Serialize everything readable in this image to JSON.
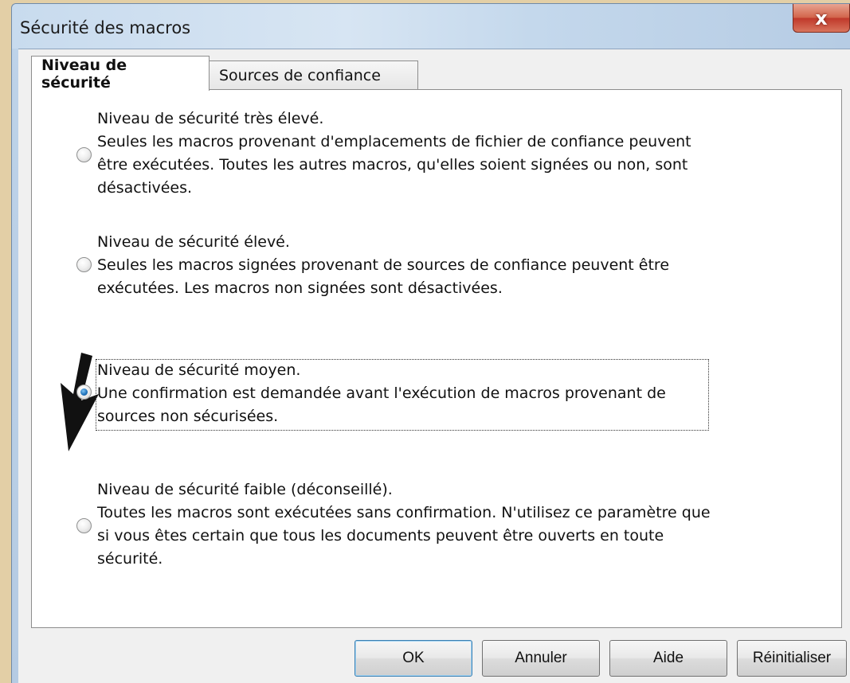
{
  "window": {
    "title": "Sécurité des macros",
    "close_label": "x"
  },
  "tabs": [
    {
      "label": "Niveau de sécurité",
      "active": true
    },
    {
      "label": "Sources de confiance",
      "active": false
    }
  ],
  "options": [
    {
      "selected": false,
      "lines": [
        "Niveau de sécurité très élevé.",
        "Seules les macros provenant d'emplacements de fichier de confiance peuvent",
        "être exécutées. Toutes les autres macros, qu'elles soient signées ou non, sont",
        "désactivées."
      ]
    },
    {
      "selected": false,
      "lines": [
        "Niveau de sécurité élevé.",
        "Seules les macros signées provenant de sources de confiance peuvent être",
        "exécutées. Les macros non signées sont désactivées."
      ]
    },
    {
      "selected": true,
      "lines": [
        "Niveau de sécurité moyen.",
        "Une confirmation est demandée avant l'exécution de macros provenant de",
        "sources non sécurisées."
      ]
    },
    {
      "selected": false,
      "lines": [
        "Niveau de sécurité faible (déconseillé).",
        "Toutes les macros sont exécutées sans confirmation. N'utilisez ce paramètre que",
        "si vous êtes certain que tous les documents peuvent être ouverts en toute",
        "sécurité."
      ]
    }
  ],
  "buttons": {
    "ok": "OK",
    "cancel": "Annuler",
    "help": "Aide",
    "reset": "Réinitialiser"
  },
  "colors": {
    "accent_radio": "#1c6fb8",
    "close_button": "#c0392b",
    "default_button_border": "#3c7fb1"
  },
  "icons": {
    "close": "close-icon",
    "annotation": "arrow-down-icon"
  }
}
